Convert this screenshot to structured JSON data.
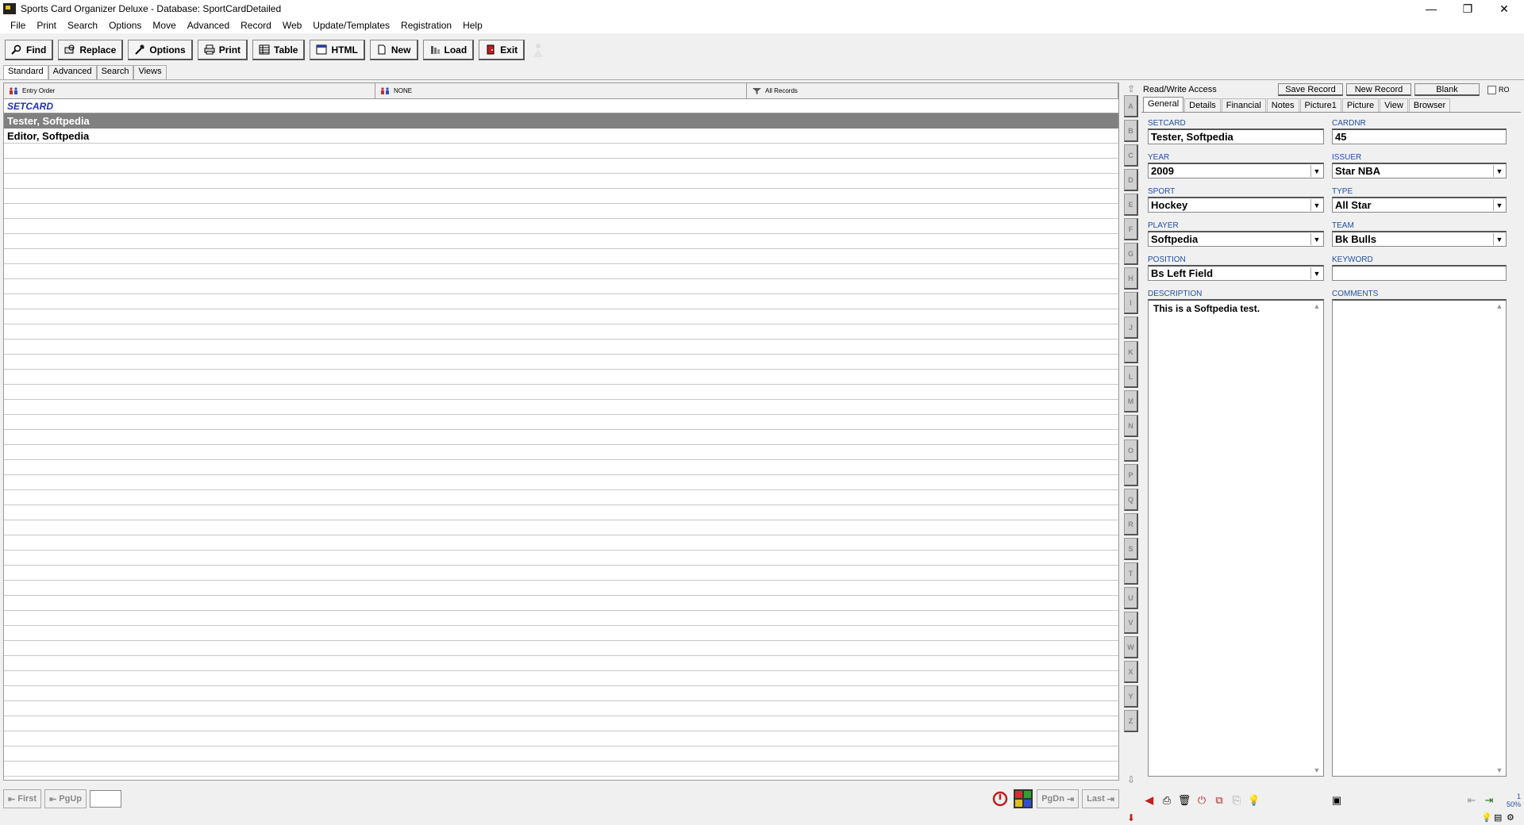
{
  "window": {
    "title": "Sports Card Organizer Deluxe - Database: SportCardDetailed",
    "minimize": "—",
    "maximize": "❐",
    "close": "✕"
  },
  "menu": [
    "File",
    "Print",
    "Search",
    "Options",
    "Move",
    "Advanced",
    "Record",
    "Web",
    "Update/Templates",
    "Registration",
    "Help"
  ],
  "toolbar": {
    "find": "Find",
    "replace": "Replace",
    "options": "Options",
    "print": "Print",
    "table": "Table",
    "html": "HTML",
    "new": "New",
    "load": "Load",
    "exit": "Exit"
  },
  "view_tabs": [
    "Standard",
    "Advanced",
    "Search",
    "Views"
  ],
  "list": {
    "sort_label": "Entry Order",
    "group_label": "NONE",
    "filter_label": "All Records",
    "column_header": "SETCARD",
    "rows": [
      "Tester, Softpedia",
      "Editor, Softpedia"
    ],
    "selected_index": 0
  },
  "alpha_index": [
    "A",
    "B",
    "C",
    "D",
    "E",
    "F",
    "G",
    "H",
    "I",
    "J",
    "K",
    "L",
    "M",
    "N",
    "O",
    "P",
    "Q",
    "R",
    "S",
    "T",
    "U",
    "V",
    "W",
    "X",
    "Y",
    "Z"
  ],
  "bottom_nav": {
    "first": "First",
    "pgup": "PgUp",
    "page_value": "",
    "pgdn": "PgDn",
    "last": "Last"
  },
  "record_bar": {
    "access": "Read/Write Access",
    "save": "Save Record",
    "new": "New Record",
    "blank": "Blank",
    "ro": "RO"
  },
  "detail_tabs": [
    "General",
    "Details",
    "Financial",
    "Notes",
    "Picture1",
    "Picture",
    "View",
    "Browser"
  ],
  "form": {
    "setcard_label": "SETCARD",
    "setcard": "Tester, Softpedia",
    "cardnr_label": "CARDNR",
    "cardnr": "45",
    "year_label": "YEAR",
    "year": "2009",
    "issuer_label": "ISSUER",
    "issuer": "Star NBA",
    "sport_label": "SPORT",
    "sport": "Hockey",
    "type_label": "TYPE",
    "type": "All Star",
    "player_label": "PLAYER",
    "player": "Softpedia",
    "team_label": "TEAM",
    "team": "Bk Bulls",
    "position_label": "POSITION",
    "position": "Bs Left Field",
    "keyword_label": "KEYWORD",
    "keyword": "",
    "description_label": "DESCRIPTION",
    "description": "This is a Softpedia test.",
    "comments_label": "COMMENTS",
    "comments": ""
  },
  "status": {
    "zoom": "50%",
    "counter": "1"
  },
  "colors": {
    "label_blue": "#2050a0",
    "header_blue": "#2030c0",
    "selected_row": "#808080"
  }
}
